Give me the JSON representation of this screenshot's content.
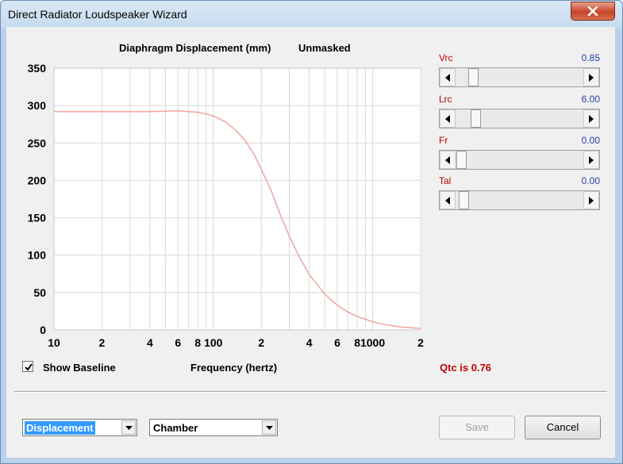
{
  "window": {
    "title": "Direct Radiator Loudspeaker Wizard"
  },
  "chart_header": {
    "title": "Diaphragm Displacement (mm)",
    "mask_state": "Unmasked"
  },
  "chart_data": {
    "type": "line",
    "title": "Diaphragm Displacement (mm)",
    "xlabel": "Frequency (hertz)",
    "ylabel": "",
    "x_scale": "log",
    "xlim": [
      10,
      2000
    ],
    "ylim": [
      0,
      350
    ],
    "y_ticks": [
      "0",
      "50",
      "100",
      "150",
      "200",
      "250",
      "300",
      "350"
    ],
    "x_ticks": [
      "10",
      "2",
      "4",
      "6",
      "8",
      "100",
      "2",
      "4",
      "6",
      "8",
      "1000",
      "2"
    ],
    "grid": true,
    "line_color": "#f4a6a6",
    "series": [
      {
        "x": [
          10,
          20,
          40,
          60,
          70,
          80,
          90,
          100,
          120,
          140,
          160,
          180,
          200,
          230,
          260,
          300,
          350,
          400,
          500,
          600,
          700,
          800,
          1000,
          1200,
          1500,
          2000
        ],
        "y": [
          292,
          292,
          292,
          293,
          292,
          291,
          289,
          286,
          278,
          266,
          252,
          235,
          215,
          187,
          157,
          125,
          96,
          74,
          48,
          33,
          24,
          18,
          11,
          7,
          4,
          2
        ]
      }
    ]
  },
  "sliders": [
    {
      "label": "Vrc",
      "value": "0.85",
      "thumb_fraction": 0.1
    },
    {
      "label": "Lrc",
      "value": "6.00",
      "thumb_fraction": 0.12
    },
    {
      "label": "Fr",
      "value": "0.00",
      "thumb_fraction": 0.0
    },
    {
      "label": "Tal",
      "value": "0.00",
      "thumb_fraction": 0.02
    }
  ],
  "show_baseline": {
    "label": "Show Baseline",
    "checked": true
  },
  "qtc": "Qtc is 0.76",
  "controls": {
    "mode_select": "Displacement",
    "enclosure_select": "Chamber",
    "save_label": "Save",
    "cancel_label": "Cancel"
  },
  "colors": {
    "accent_red": "#c00000",
    "value_blue": "#2040b0",
    "curve": "#f4a6a6",
    "select_highlight": "#3399ff"
  }
}
